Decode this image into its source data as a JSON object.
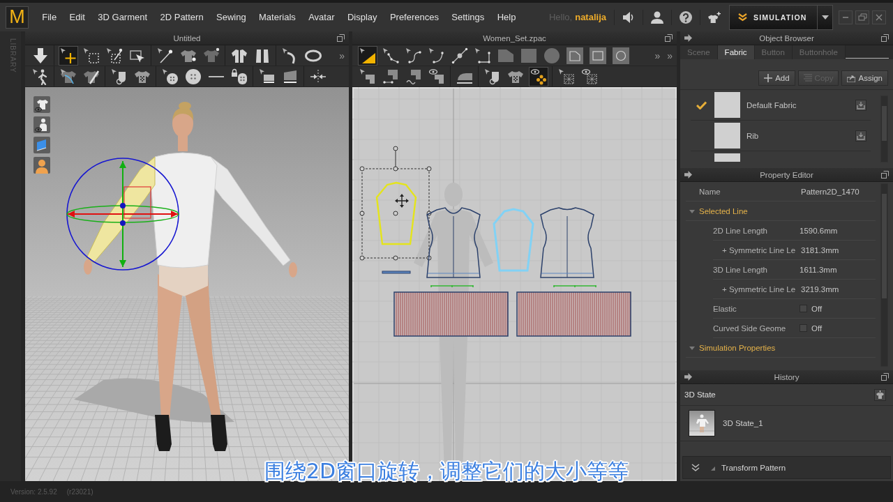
{
  "app": {
    "logo": "M",
    "menus": [
      "File",
      "Edit",
      "3D Garment",
      "2D Pattern",
      "Sewing",
      "Materials",
      "Avatar",
      "Display",
      "Preferences",
      "Settings",
      "Help"
    ],
    "greeting": "Hello,",
    "user_name": "natalija",
    "mode_button": "SIMULATION"
  },
  "library_tab": "LIBRARY",
  "view_3d": {
    "title": "Untitled",
    "toolbars": [
      {
        "groups": [
          {
            "tools": [
              {
                "kind": "arrow-down",
                "selected": false
              }
            ]
          },
          {
            "tools": [
              {
                "kind": "cursor-plus",
                "selected": true
              },
              {
                "kind": "dashed-square",
                "selected": false
              },
              {
                "kind": "dashed-square-arrow",
                "selected": false
              },
              {
                "kind": "square-arrow",
                "selected": false
              }
            ]
          },
          {
            "tools": [
              {
                "kind": "pin-line",
                "selected": false
              },
              {
                "kind": "shirt-pin",
                "selected": false
              },
              {
                "kind": "shirt-dot",
                "selected": false
              }
            ]
          },
          {
            "tools": [
              {
                "kind": "jacket",
                "selected": false
              },
              {
                "kind": "vest",
                "selected": false
              }
            ]
          },
          {
            "tools": [
              {
                "kind": "tape-curve",
                "selected": false
              },
              {
                "kind": "tape-ring",
                "selected": false
              }
            ]
          }
        ],
        "more": [
          "»"
        ]
      },
      {
        "groups": [
          {
            "tools": [
              {
                "kind": "walker",
                "selected": false
              }
            ]
          },
          {
            "tools": [
              {
                "kind": "shirt-curve",
                "selected": false
              },
              {
                "kind": "shirt-pen",
                "selected": false
              }
            ]
          },
          {
            "tools": [
              {
                "kind": "pointer-cup",
                "selected": false
              },
              {
                "kind": "checker-shirt",
                "selected": false
              }
            ]
          },
          {
            "tools": [
              {
                "kind": "pointer-button",
                "selected": false
              },
              {
                "kind": "sewing-button",
                "selected": false
              },
              {
                "kind": "line",
                "selected": false
              },
              {
                "kind": "padlock-button",
                "selected": false
              }
            ]
          },
          {
            "tools": [
              {
                "kind": "pointer-plank",
                "selected": false
              },
              {
                "kind": "plank",
                "selected": false
              }
            ]
          },
          {
            "tools": [
              {
                "kind": "pinch-arrows",
                "selected": false
              }
            ]
          }
        ]
      }
    ],
    "side_tools": [
      {
        "kind": "shirt-eye"
      },
      {
        "kind": "figure-eye"
      },
      {
        "kind": "sheet"
      },
      {
        "kind": "avatar-bust"
      }
    ]
  },
  "view_2d": {
    "title": "Women_Set.zpac",
    "toolbars": [
      {
        "groups": [
          {
            "tools": [
              {
                "kind": "pointer-triangle",
                "selected": true
              },
              {
                "kind": "pointer-polyline",
                "selected": false
              },
              {
                "kind": "pointer-curve",
                "selected": false
              },
              {
                "kind": "pointer-corner",
                "selected": false
              },
              {
                "kind": "line-dot",
                "selected": false
              },
              {
                "kind": "pointer-angle",
                "selected": false
              },
              {
                "kind": "notched-shape",
                "selected": false
              },
              {
                "kind": "square-shape",
                "selected": false
              },
              {
                "kind": "circle-shape",
                "selected": false
              },
              {
                "kind": "framed-notched",
                "selected": false
              },
              {
                "kind": "framed-square",
                "selected": false
              },
              {
                "kind": "framed-circle",
                "selected": false
              }
            ]
          }
        ],
        "more": [
          "»",
          "»"
        ]
      },
      {
        "groups": [
          {
            "tools": [
              {
                "kind": "pointer-seam",
                "selected": false
              },
              {
                "kind": "seam-segment",
                "selected": false
              },
              {
                "kind": "seam-wave",
                "selected": false
              },
              {
                "kind": "eye-seam",
                "selected": false
              }
            ]
          },
          {
            "tools": [
              {
                "kind": "iron",
                "selected": false
              }
            ]
          },
          {
            "tools": [
              {
                "kind": "pointer-cup",
                "selected": false
              },
              {
                "kind": "checker-shirt",
                "selected": false
              },
              {
                "kind": "eye-dots",
                "selected": true
              }
            ]
          },
          {
            "tools": [
              {
                "kind": "pointer-lattice",
                "selected": false
              },
              {
                "kind": "eye-lattice",
                "selected": false
              }
            ]
          }
        ]
      }
    ],
    "pieces": [
      {
        "kind": "sleeve",
        "selected": true,
        "highlighted": false
      },
      {
        "kind": "front-bodice",
        "selected": false,
        "highlighted": false
      },
      {
        "kind": "sleeve",
        "selected": false,
        "highlighted": true
      },
      {
        "kind": "back-bodice",
        "selected": false,
        "highlighted": false
      },
      {
        "kind": "strip",
        "selected": false,
        "highlighted": false
      },
      {
        "kind": "rib",
        "selected": false,
        "highlighted": false
      },
      {
        "kind": "rib",
        "selected": false,
        "highlighted": false
      }
    ]
  },
  "object_browser": {
    "title": "Object Browser",
    "tabs": [
      {
        "label": "Scene",
        "selected": false
      },
      {
        "label": "Fabric",
        "selected": true
      },
      {
        "label": "Button",
        "selected": false
      },
      {
        "label": "Buttonhole",
        "selected": false
      }
    ],
    "actions": [
      {
        "kind": "add",
        "label": "Add",
        "disabled": false
      },
      {
        "kind": "copy",
        "label": "Copy",
        "disabled": true
      },
      {
        "kind": "assign",
        "label": "Assign",
        "disabled": false
      }
    ],
    "fabrics": [
      {
        "name": "Default Fabric",
        "checked": true
      },
      {
        "name": "Rib",
        "checked": false
      },
      {
        "checked": false
      }
    ]
  },
  "property_editor": {
    "title": "Property Editor",
    "rows": [
      {
        "kind": "field",
        "label": "Name",
        "value": "Pattern2D_1470"
      },
      {
        "kind": "section",
        "label": "Selected Line",
        "expanded": true,
        "children": [
          {
            "kind": "field",
            "label": "2D Line Length",
            "value": "1590.6mm",
            "children": [
              {
                "kind": "field",
                "label": "+ Symmetric Line Le",
                "value": "3181.3mm"
              }
            ]
          },
          {
            "kind": "field",
            "label": "3D Line Length",
            "value": "1611.3mm",
            "children": [
              {
                "kind": "field",
                "label": "+ Symmetric Line Le",
                "value": "3219.3mm"
              }
            ]
          },
          {
            "kind": "toggle",
            "label": "Elastic",
            "checked": false,
            "value": "Off"
          },
          {
            "kind": "toggle",
            "label": "Curved Side Geome",
            "checked": false,
            "value": "Off"
          }
        ]
      },
      {
        "kind": "section",
        "label": "Simulation Properties",
        "expanded": true
      }
    ]
  },
  "history": {
    "title": "History",
    "group": "3D State",
    "states": [
      {
        "name": "3D State_1"
      }
    ]
  },
  "tool_panel": {
    "title": "Transform Pattern"
  },
  "status_bar": {
    "version": "Version: 2.5.92",
    "build": "(r23021)"
  },
  "subtitle": "围绕2D窗口旋转，调整它们的大小等等"
}
